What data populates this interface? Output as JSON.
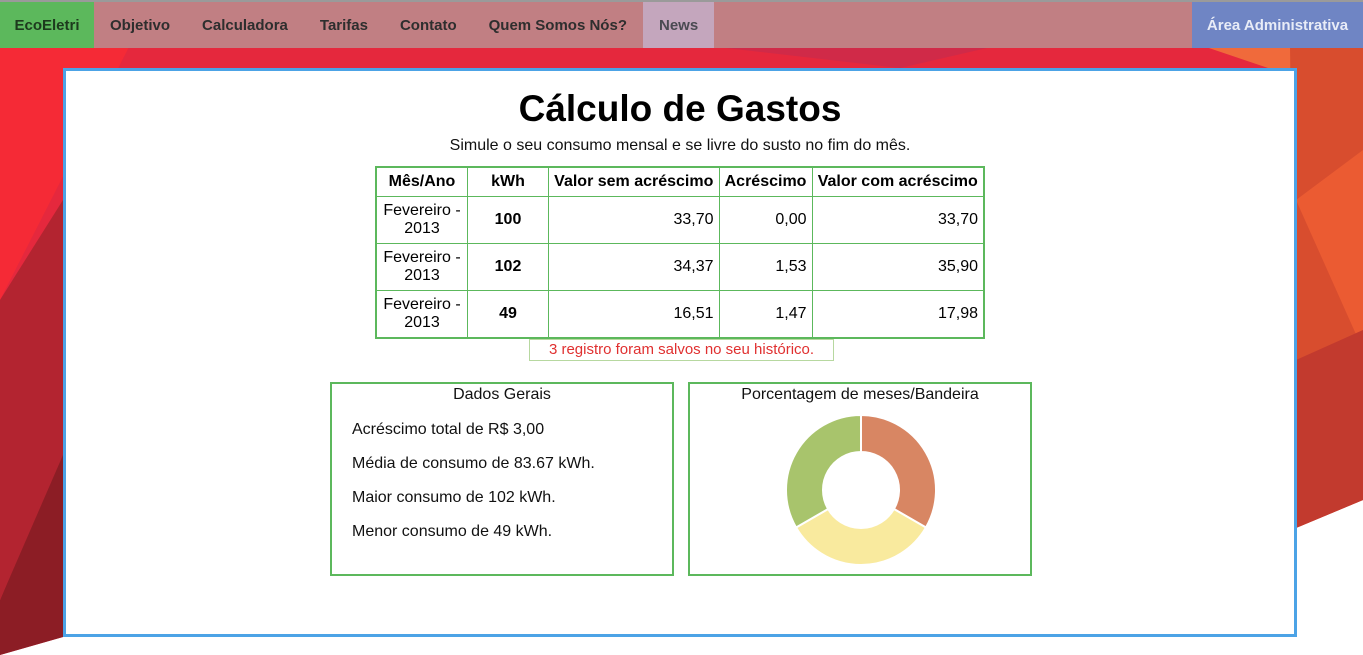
{
  "nav": {
    "brand": "EcoEletri",
    "items": [
      "Objetivo",
      "Calculadora",
      "Tarifas",
      "Contato",
      "Quem Somos Nós?",
      "News"
    ],
    "admin": "Área Administrativa"
  },
  "page": {
    "title": "Cálculo de Gastos",
    "subtitle": "Simule o seu consumo mensal e se livre do susto no fim do mês."
  },
  "table": {
    "headers": [
      "Mês/Ano",
      "kWh",
      "Valor sem acréscimo",
      "Acréscimo",
      "Valor com acréscimo"
    ],
    "rows": [
      {
        "mes": "Fevereiro - 2013",
        "kwh": "100",
        "sem": "33,70",
        "acr": "0,00",
        "com": "33,70"
      },
      {
        "mes": "Fevereiro - 2013",
        "kwh": "102",
        "sem": "34,37",
        "acr": "1,53",
        "com": "35,90"
      },
      {
        "mes": "Fevereiro - 2013",
        "kwh": "49",
        "sem": "16,51",
        "acr": "1,47",
        "com": "17,98"
      }
    ]
  },
  "saved_message": "3 registro foram salvos no seu histórico.",
  "general": {
    "title": "Dados Gerais",
    "lines": [
      "Acréscimo total de R$ 3,00",
      "Média de consumo de 83.67 kWh.",
      "Maior consumo de 102 kWh.",
      "Menor consumo de 49 kWh."
    ]
  },
  "percent_chart": {
    "title": "Porcentagem de meses/Bandeira"
  },
  "chart_data": {
    "type": "pie",
    "title": "Porcentagem de meses/Bandeira",
    "categories": [
      "",
      "",
      ""
    ],
    "values": [
      33.33,
      33.33,
      33.34
    ],
    "colors": [
      "#d88663",
      "#f9ea9e",
      "#a8c46c"
    ]
  },
  "colors": {
    "accent_green": "#5cb85c",
    "panel_border": "#4ca3e6",
    "message_red": "#e03030"
  }
}
